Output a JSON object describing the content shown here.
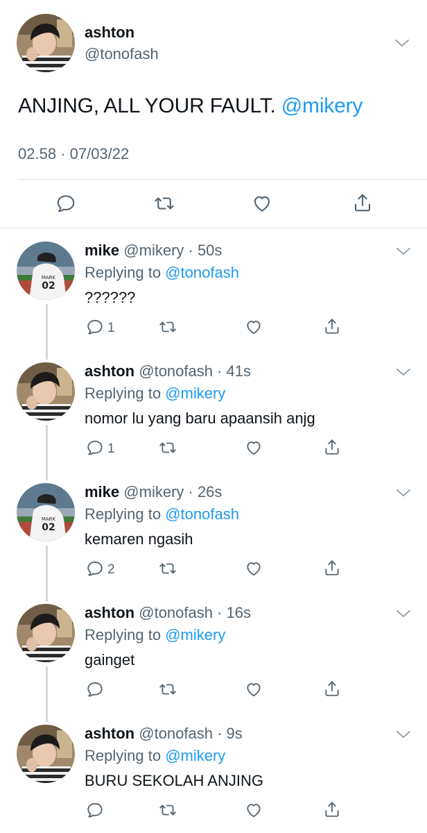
{
  "main_tweet": {
    "name": "ashton",
    "handle": "@tonofash",
    "text": "ANJING, ALL YOUR FAULT.",
    "mention": "@mikery",
    "meta": "02.58 · 07/03/22",
    "icons": [
      "reply-icon",
      "retweet-icon",
      "like-icon",
      "share-icon"
    ]
  },
  "replies": [
    {
      "name": "mike",
      "handle_time": "@mikery · 50s",
      "replying_prefix": "Replying to",
      "replying_to": "@tonofash",
      "text": "??????",
      "reply_count": "1",
      "retweet_count": "",
      "like_count": ""
    },
    {
      "name": "ashton",
      "handle_time": "@tonofash · 41s",
      "replying_prefix": "Replying to",
      "replying_to": "@mikery",
      "text": "nomor lu yang baru apaansih anjg",
      "reply_count": "1",
      "retweet_count": "",
      "like_count": ""
    },
    {
      "name": "mike",
      "handle_time": "@mikery · 26s",
      "replying_prefix": "Replying to",
      "replying_to": "@tonofash",
      "text": "kemaren ngasih",
      "reply_count": "2",
      "retweet_count": "",
      "like_count": ""
    },
    {
      "name": "ashton",
      "handle_time": "@tonofash · 16s",
      "replying_prefix": "Replying to",
      "replying_to": "@mikery",
      "text": "gainget",
      "reply_count": "",
      "retweet_count": "",
      "like_count": ""
    },
    {
      "name": "ashton",
      "handle_time": "@tonofash · 9s",
      "replying_prefix": "Replying to",
      "replying_to": "@mikery",
      "text": "BURU SEKOLAH ANJING",
      "reply_count": "",
      "retweet_count": "",
      "like_count": ""
    }
  ],
  "colors": {
    "accent": "#1d9bf0",
    "secondary_text": "#536471",
    "primary_text": "#0f1419",
    "divider": "#dfe3e7"
  }
}
